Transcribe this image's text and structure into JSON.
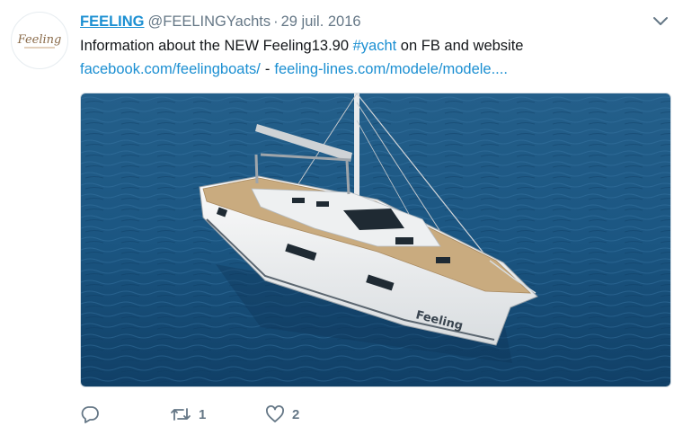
{
  "author": {
    "name": "FEELING",
    "handle": "@FEELINGYachts",
    "separator": "·",
    "date": "29 juil. 2016",
    "avatar_text": "Feeling"
  },
  "tweet": {
    "text_before": "Information about the NEW Feeling13.90 ",
    "hashtag": "#yacht",
    "text_after": " on FB and website",
    "link1": "facebook.com/feelingboats/",
    "link_separator": "-",
    "link2": "feeling-lines.com/modele/modele...."
  },
  "media": {
    "hull_brand": "Feeling"
  },
  "actions": {
    "reply_count": "",
    "retweet_count": "1",
    "like_count": "2"
  },
  "colors": {
    "link": "#1b8fd2",
    "muted": "#657786",
    "sea": "#1f5a84"
  },
  "icons": [
    "chevron-down-icon",
    "reply-icon",
    "retweet-icon",
    "heart-icon"
  ]
}
